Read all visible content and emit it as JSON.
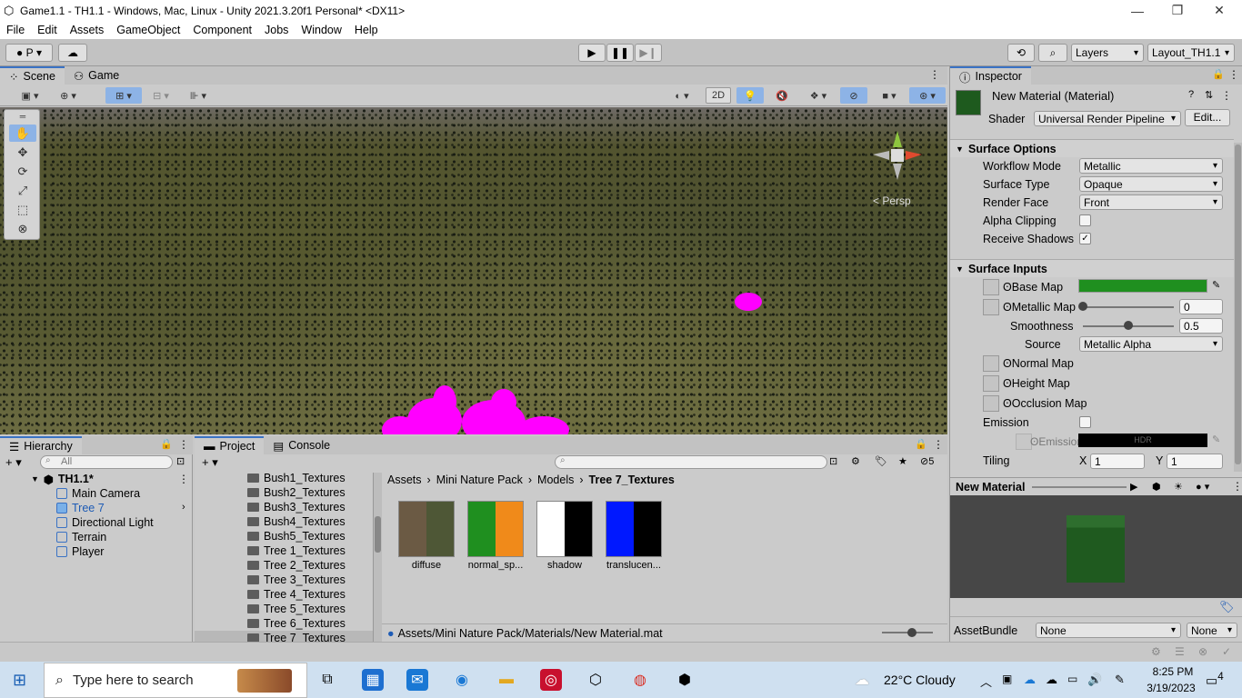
{
  "window": {
    "title": "Game1.1 - TH1.1 - Windows, Mac, Linux - Unity 2021.3.20f1 Personal* <DX11>"
  },
  "menu": [
    "File",
    "Edit",
    "Assets",
    "GameObject",
    "Component",
    "Jobs",
    "Window",
    "Help"
  ],
  "toolbar": {
    "account_label": "P",
    "layers_label": "Layers",
    "layout_label": "Layout_TH1.1"
  },
  "scene_tabs": {
    "scene": "Scene",
    "game": "Game"
  },
  "scene_tools": {
    "mode_2d": "2D",
    "persp_label": "< Persp"
  },
  "hierarchy": {
    "tab": "Hierarchy",
    "search_placeholder": "All",
    "scene_name": "TH1.1*",
    "items": [
      "Main Camera",
      "Tree 7",
      "Directional Light",
      "Terrain",
      "Player"
    ]
  },
  "project": {
    "tab_project": "Project",
    "tab_console": "Console",
    "folders": [
      "Bush1_Textures",
      "Bush2_Textures",
      "Bush3_Textures",
      "Bush4_Textures",
      "Bush5_Textures",
      "Tree 1_Textures",
      "Tree 2_Textures",
      "Tree 3_Textures",
      "Tree 4_Textures",
      "Tree 5_Textures",
      "Tree 6_Textures",
      "Tree 7_Textures"
    ],
    "breadcrumb": [
      "Assets",
      "Mini Nature Pack",
      "Models",
      "Tree 7_Textures"
    ],
    "assets": [
      "diffuse",
      "normal_sp...",
      "shadow",
      "translucen..."
    ],
    "selected_path": "Assets/Mini Nature Pack/Materials/New Material.mat",
    "hidden_count": "5"
  },
  "inspector": {
    "tab": "Inspector",
    "material_name": "New Material (Material)",
    "shader_label": "Shader",
    "shader_value": "Universal Render Pipeline",
    "edit_label": "Edit...",
    "surface_options": {
      "header": "Surface Options",
      "workflow_label": "Workflow Mode",
      "workflow_value": "Metallic",
      "surface_type_label": "Surface Type",
      "surface_type_value": "Opaque",
      "render_face_label": "Render Face",
      "render_face_value": "Front",
      "alpha_clipping_label": "Alpha Clipping",
      "receive_shadows_label": "Receive Shadows",
      "receive_shadows_check": "✓"
    },
    "surface_inputs": {
      "header": "Surface Inputs",
      "base_map": "Base Map",
      "base_color": "#1f8f1f",
      "metallic_map": "Metallic Map",
      "metallic_value": "0",
      "metallic_level": 0,
      "smoothness": "Smoothness",
      "smoothness_value": "0.5",
      "smoothness_level": 0.5,
      "source": "Source",
      "source_value": "Metallic Alpha",
      "normal_map": "Normal Map",
      "height_map": "Height Map",
      "occlusion_map": "Occlusion Map",
      "emission": "Emission",
      "emission_map": "Emission",
      "hdr": "HDR",
      "tiling": "Tiling",
      "x": "X",
      "y": "Y",
      "tiling_x": "1",
      "tiling_y": "1"
    },
    "preview": {
      "title": "New Material"
    },
    "assetbundle": {
      "label": "AssetBundle",
      "value": "None",
      "variant": "None"
    }
  },
  "taskbar": {
    "search_placeholder": "Type here to search",
    "weather": "22°C  Cloudy",
    "time": "8:25 PM",
    "date": "3/19/2023",
    "notifications": "4"
  },
  "colors": {
    "accent": "#3a72c4",
    "magenta": "#ff00ff",
    "base_map": "#1f8f1f"
  }
}
